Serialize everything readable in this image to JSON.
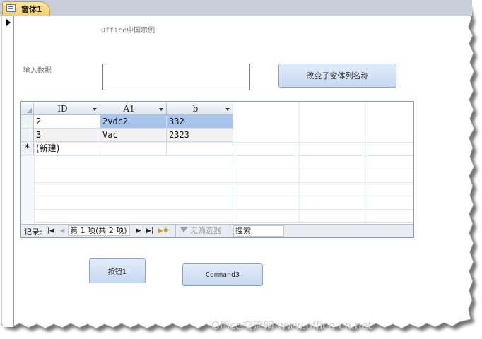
{
  "tab": {
    "label": "窗体1"
  },
  "form": {
    "title_label": "Office中国示例",
    "input_label": "输入数据",
    "input_value": "",
    "rename_button_label": "改变子窗体列名称",
    "button1_label": "按钮1",
    "command3_label": "Command3"
  },
  "datasheet": {
    "columns": [
      {
        "label": "ID"
      },
      {
        "label": "A1"
      },
      {
        "label": "b"
      }
    ],
    "rows": [
      {
        "selector": "",
        "cells": [
          "2",
          "2vdc2",
          "332"
        ]
      },
      {
        "selector": "",
        "cells": [
          "3",
          "Vac",
          "2323"
        ]
      },
      {
        "selector": "*",
        "cells": [
          "(新建)",
          "",
          ""
        ]
      }
    ],
    "nav": {
      "label": "记录:",
      "position_text": "第 1 项(共 2 项)",
      "filter_text": "无筛选器",
      "search_text": "搜索",
      "first_icon": "first-record-icon",
      "prev_icon": "prev-record-icon",
      "next_icon": "next-record-icon",
      "last_icon": "last-record-icon",
      "new_icon": "new-record-icon"
    }
  },
  "watermark": "Office交流网 www.office-cn.net"
}
